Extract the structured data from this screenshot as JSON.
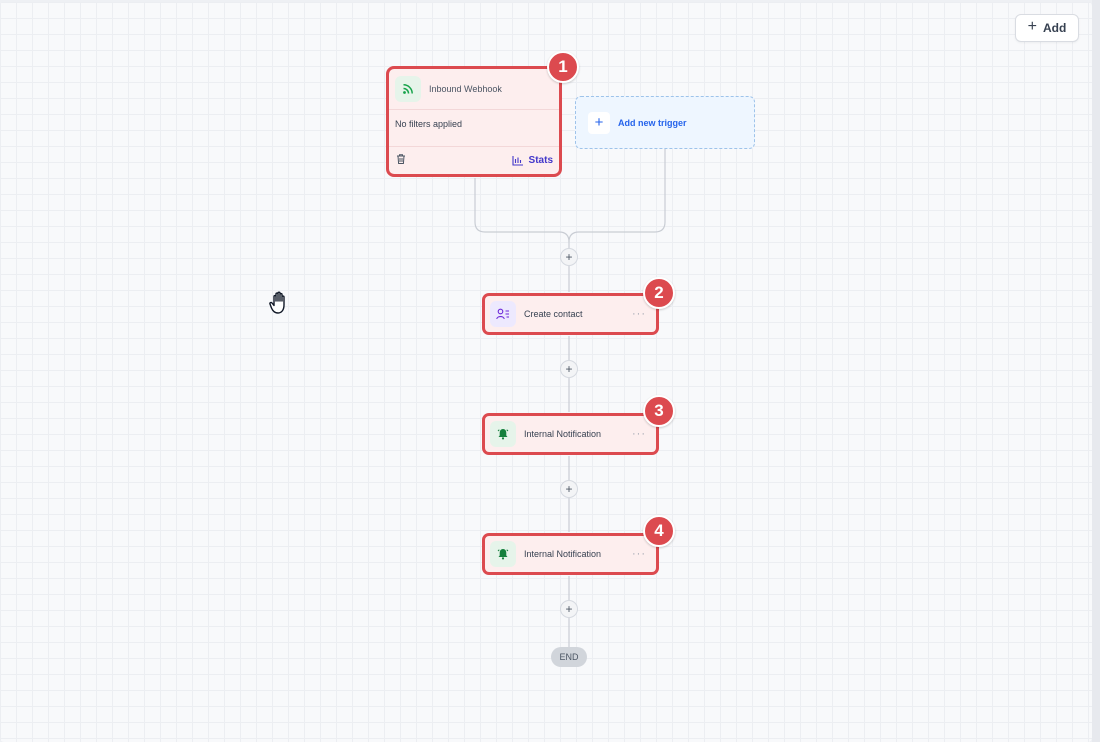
{
  "toolbar": {
    "add_label": "Add",
    "add_icon": "plus-icon"
  },
  "trigger": {
    "title": "Inbound Webhook",
    "icon": "webhook-rss-icon",
    "filters_text": "No filters applied",
    "stats_label": "Stats",
    "badge": "1"
  },
  "new_trigger": {
    "label": "Add new trigger"
  },
  "actions": [
    {
      "label": "Create contact",
      "icon": "contact-icon",
      "badge": "2",
      "more": "···"
    },
    {
      "label": "Internal Notification",
      "icon": "bell-icon",
      "badge": "3",
      "more": "···"
    },
    {
      "label": "Internal Notification",
      "icon": "bell-icon",
      "badge": "4",
      "more": "···"
    }
  ],
  "plus_nodes": [
    "+",
    "+",
    "+",
    "+"
  ],
  "end_label": "END",
  "colors": {
    "highlight": "#dc4a4f",
    "highlight_fill": "#fdeeee",
    "accent_blue": "#2563eb",
    "icon_green": "#16a34a"
  }
}
